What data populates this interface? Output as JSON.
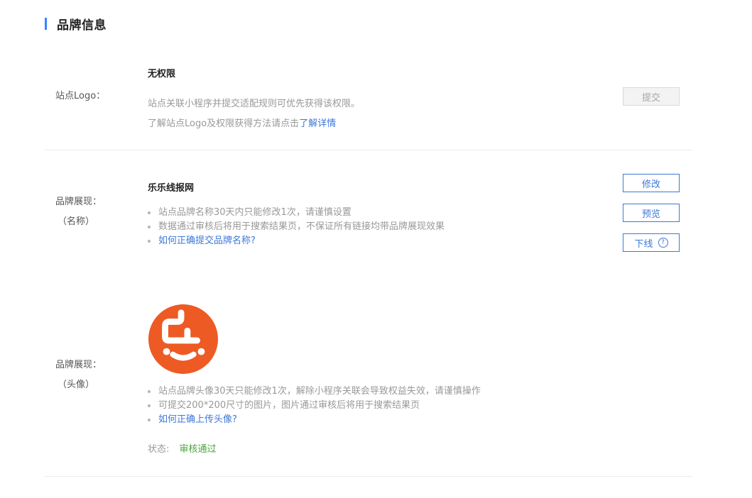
{
  "section": {
    "title": "品牌信息"
  },
  "logo_row": {
    "label": "站点Logo：",
    "title": "无权限",
    "desc1": "站点关联小程序并提交适配规则可优先获得该权限。",
    "desc2_prefix": "了解站点Logo及权限获得方法请点击",
    "desc2_link": "了解详情",
    "submit_label": "提交"
  },
  "name_row": {
    "label_line1": "品牌展现：",
    "label_line2": "（名称）",
    "title": "乐乐线报网",
    "bullets": [
      "站点品牌名称30天内只能修改1次，请谨慎设置",
      "数据通过审核后将用于搜索结果页，不保证所有链接均带品牌展现效果"
    ],
    "help_link": "如何正确提交品牌名称?",
    "modify_label": "修改",
    "preview_label": "预览",
    "offline_label": "下线",
    "offline_help_glyph": "?"
  },
  "avatar_row": {
    "label_line1": "品牌展现：",
    "label_line2": "（头像）",
    "avatar_color": "#ee5a24",
    "bullets": [
      "站点品牌头像30天只能修改1次，解除小程序关联会导致权益失效，请谨慎操作",
      "可提交200*200尺寸的图片，图片通过审核后将用于搜索结果页"
    ],
    "help_link": "如何正确上传头像?",
    "status_label": "状态:",
    "status_value": "审核通过"
  },
  "colors": {
    "accent": "#3385ff",
    "link": "#3c78d8",
    "success": "#4aa53c"
  }
}
